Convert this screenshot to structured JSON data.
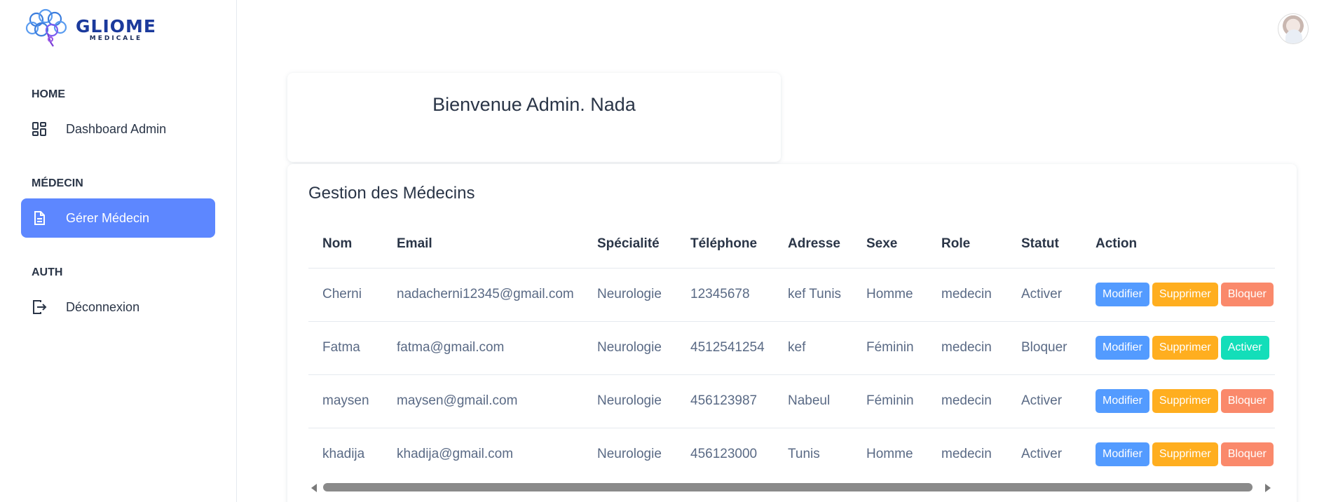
{
  "brand": {
    "title": "GLIOME",
    "subtitle": "MEDICALE"
  },
  "sidebar": {
    "sections": [
      {
        "label": "HOME",
        "items": [
          {
            "label": "Dashboard Admin",
            "icon": "dashboard-grid-icon",
            "active": false
          }
        ]
      },
      {
        "label": "MÉDECIN",
        "items": [
          {
            "label": "Gérer Médecin",
            "icon": "document-icon",
            "active": true
          }
        ]
      },
      {
        "label": "AUTH",
        "items": [
          {
            "label": "Déconnexion",
            "icon": "logout-icon",
            "active": false
          }
        ]
      }
    ]
  },
  "welcome": {
    "title": "Bienvenue Admin. Nada"
  },
  "doctors": {
    "title": "Gestion des Médecins",
    "columns": [
      "Nom",
      "Email",
      "Spécialité",
      "Téléphone",
      "Adresse",
      "Sexe",
      "Role",
      "Statut",
      "Action"
    ],
    "rows": [
      {
        "nom": "Cherni",
        "email": "nadacherni12345@gmail.com",
        "specialite": "Neurologie",
        "telephone": "12345678",
        "adresse": "kef Tunis",
        "sexe": "Homme",
        "role": "medecin",
        "statut": "Activer",
        "actions": [
          "Modifier",
          "Supprimer",
          "Bloquer"
        ]
      },
      {
        "nom": "Fatma",
        "email": "fatma@gmail.com",
        "specialite": "Neurologie",
        "telephone": "4512541254",
        "adresse": "kef",
        "sexe": "Féminin",
        "role": "medecin",
        "statut": "Bloquer",
        "actions": [
          "Modifier",
          "Supprimer",
          "Activer"
        ]
      },
      {
        "nom": "maysen",
        "email": "maysen@gmail.com",
        "specialite": "Neurologie",
        "telephone": "456123987",
        "adresse": "Nabeul",
        "sexe": "Féminin",
        "role": "medecin",
        "statut": "Activer",
        "actions": [
          "Modifier",
          "Supprimer",
          "Bloquer"
        ]
      },
      {
        "nom": "khadija",
        "email": "khadija@gmail.com",
        "specialite": "Neurologie",
        "telephone": "456123000",
        "adresse": "Tunis",
        "sexe": "Homme",
        "role": "medecin",
        "statut": "Activer",
        "actions": [
          "Modifier",
          "Supprimer",
          "Bloquer"
        ]
      }
    ]
  },
  "colors": {
    "primary": "#5d87ff",
    "modify": "#539bff",
    "delete": "#ffae1f",
    "block": "#fa896b",
    "activate": "#13deb9"
  }
}
